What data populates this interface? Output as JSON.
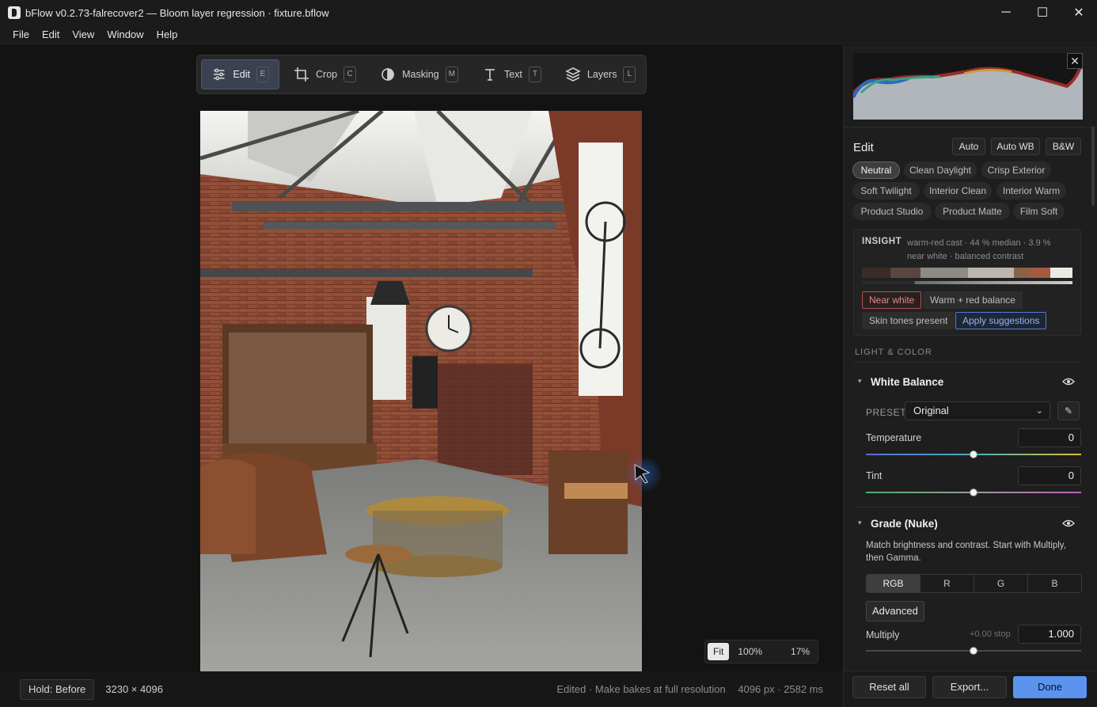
{
  "window": {
    "title": "bFlow v0.2.73-falrecover2 — Bloom layer regression · fixture.bflow",
    "minimize": "─",
    "maximize": "☐",
    "close": "✕"
  },
  "menu": [
    "File",
    "Edit",
    "View",
    "Window",
    "Help"
  ],
  "toolbar": {
    "tools": [
      {
        "label": "Edit",
        "key": "E",
        "icon": "sliders-icon",
        "active": true
      },
      {
        "label": "Crop",
        "key": "C",
        "icon": "crop-icon",
        "active": false
      },
      {
        "label": "Masking",
        "key": "M",
        "icon": "mask-icon",
        "active": false
      },
      {
        "label": "Text",
        "key": "T",
        "icon": "text-icon",
        "active": false
      },
      {
        "label": "Layers",
        "key": "L",
        "icon": "layers-icon",
        "active": false
      }
    ]
  },
  "zoom": {
    "fit": "Fit",
    "actual": "100%",
    "current": "17%"
  },
  "status": {
    "hold": "Hold: Before",
    "dimensions": "3230 × 4096",
    "edited": "Edited · Make bakes at full resolution",
    "render": "4096 px · 2582 ms"
  },
  "panel": {
    "close": "✕",
    "edit_title": "Edit",
    "auto": "Auto",
    "auto_wb": "Auto WB",
    "bw": "B&W",
    "presets": [
      "Neutral",
      "Clean Daylight",
      "Crisp Exterior",
      "Soft Twilight",
      "Interior Clean",
      "Interior Warm",
      "Product Studio",
      "Product Matte",
      "Film Soft"
    ],
    "insight": {
      "label": "INSIGHT",
      "text": "warm-red cast · 44 % median · 3.9 % near white · balanced contrast",
      "swatches": [
        "#3a2c26",
        "#5a463e",
        "#8e8a86",
        "#bdb6ae",
        "#8a6248",
        "#a45a3e",
        "#ece8e4"
      ],
      "tags": {
        "near_white": "Near white",
        "warm_red": "Warm + red balance",
        "skin": "Skin tones present",
        "apply": "Apply suggestions"
      }
    },
    "section_light": "LIGHT & COLOR",
    "white_balance": {
      "title": "White Balance",
      "preset_label": "PRESET",
      "preset_value": "Original",
      "temperature_label": "Temperature",
      "temperature_value": "0",
      "tint_label": "Tint",
      "tint_value": "0"
    },
    "grade": {
      "title": "Grade (Nuke)",
      "description": "Match brightness and contrast. Start with Multiply, then Gamma.",
      "channels": [
        "RGB",
        "R",
        "G",
        "B"
      ],
      "advanced": "Advanced",
      "multiply_label": "Multiply",
      "multiply_hint": "+0.00 stop",
      "multiply_value": "1.000"
    },
    "footer": {
      "reset": "Reset all",
      "export": "Export...",
      "done": "Done"
    }
  },
  "colors": {
    "accent": "#5b93ef",
    "warn": "#b15050"
  }
}
